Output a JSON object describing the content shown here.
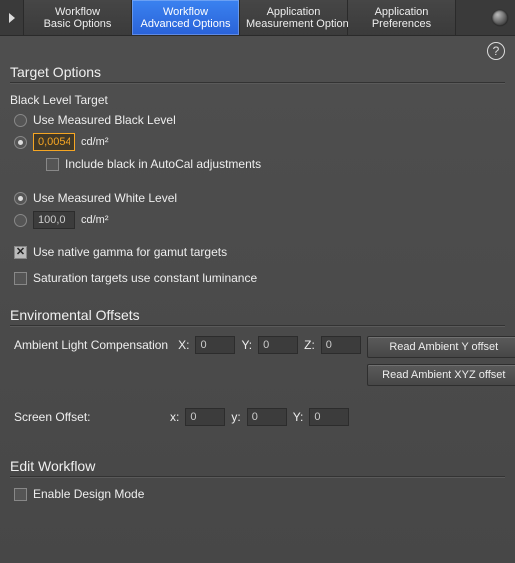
{
  "tabs": [
    {
      "l1": "Workflow",
      "l2": "Basic Options",
      "active": false
    },
    {
      "l1": "Workflow",
      "l2": "Advanced Options",
      "active": true
    },
    {
      "l1": "Application",
      "l2": "Measurement Options",
      "active": false
    },
    {
      "l1": "Application",
      "l2": "Preferences",
      "active": false
    }
  ],
  "help_glyph": "?",
  "sections": {
    "target_options": "Target Options",
    "env_offsets": "Enviromental Offsets",
    "edit_workflow": "Edit Workflow"
  },
  "black_level": {
    "title": "Black Level Target",
    "use_measured_label": "Use Measured Black Level",
    "value": "0,0054",
    "unit": "cd/m²",
    "include_autocal_label": "Include black in AutoCal adjustments",
    "selected": "value",
    "include_autocal": false
  },
  "white_level": {
    "use_measured_label": "Use Measured White Level",
    "value": "100,0",
    "unit": "cd/m²",
    "selected": "measured"
  },
  "native_gamma": {
    "label": "Use native gamma for gamut targets",
    "checked": true
  },
  "sat_const_lum": {
    "label": "Saturation targets use constant luminance",
    "checked": false
  },
  "ambient": {
    "label": "Ambient Light Compensation",
    "X_l": "X:",
    "Y_l": "Y:",
    "Z_l": "Z:",
    "X": "0",
    "Y": "0",
    "Z": "0",
    "btn_y": "Read Ambient Y offset",
    "btn_xyz": "Read Ambient XYZ offset"
  },
  "screen_offset": {
    "label": "Screen Offset:",
    "x_l": "x:",
    "y_l": "y:",
    "Y_l": "Y:",
    "x": "0",
    "y": "0",
    "Y": "0"
  },
  "design_mode": {
    "label": "Enable Design Mode",
    "checked": false
  }
}
